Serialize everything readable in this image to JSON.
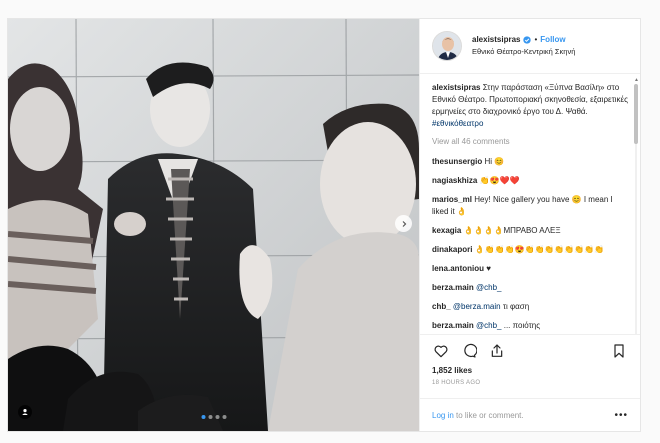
{
  "post": {
    "username": "alexistsipras",
    "follow_label": "Follow",
    "location": "Εθνικό Θέατρο-Κεντρική Σκηνή",
    "verified_color": "#3897f0",
    "caption": {
      "username": "alexistsipras",
      "text": "Στην παράσταση «Ξύπνα Βασίλη» στο Εθνικό Θέατρο. Πρωτοποριακή σκηνοθεσία, εξαιρετικές ερμηνείες στο διαχρονικό έργο του Δ. Ψαθά.",
      "hashtag": "#εθνικόθεατρο"
    },
    "view_all": "View all 46 comments",
    "comments": [
      {
        "user": "thesunsergio",
        "text": "Hi 😊"
      },
      {
        "user": "nagiaskhiza",
        "text": "👏😍❤️❤️"
      },
      {
        "user": "marios_ml",
        "text": "Hey! Nice gallery you have 😊 I mean I liked it 👌"
      },
      {
        "user": "kexagia",
        "text": "👌👌👌👌ΜΠΡΑΒΟ ΑΛΕΞ"
      },
      {
        "user": "dinakapori",
        "text": "👌👏👏👏😍👏👏👏👏👏👏👏👏"
      },
      {
        "user": "lena.antoniou",
        "text": "♥"
      },
      {
        "user": "berza.main",
        "mention": "@chb_",
        "text": ""
      },
      {
        "user": "chb_",
        "mention": "@berza.main",
        "text": " τι φαση"
      },
      {
        "user": "berza.main",
        "mention": "@chb_",
        "text": " ... ποιότης"
      }
    ],
    "likes": "1,852 likes",
    "age": "18 HOURS AGO",
    "login_link": "Log in",
    "login_suffix": " to like or comment.",
    "more_label": "•••",
    "icons": {
      "like": "heart-icon",
      "comment": "comment-icon",
      "share": "share-icon",
      "save": "bookmark-icon",
      "next": "chevron-right-icon",
      "tag": "user-tag-icon"
    },
    "carousel": {
      "count": 4,
      "active": 1
    }
  }
}
